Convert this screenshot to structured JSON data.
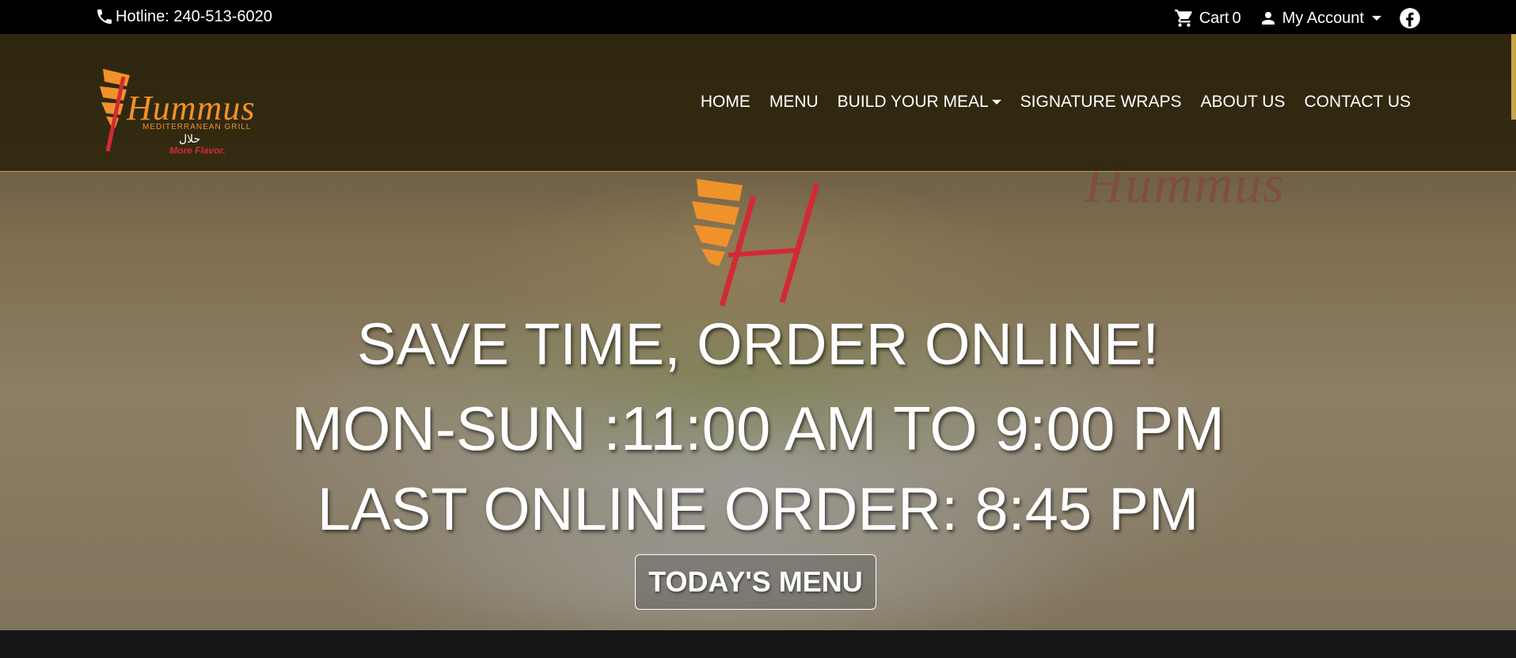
{
  "topbar": {
    "hotline": "Hotline: 240-513-6020",
    "cart_label": "Cart",
    "cart_count": "0",
    "account_label": "My Account"
  },
  "logo": {
    "word": "Hummus",
    "subtitle": "MEDITERRANEAN GRILL",
    "arabic": "حلال",
    "tagline": "More Flavor."
  },
  "nav": {
    "items": [
      "HOME",
      "MENU",
      "BUILD YOUR MEAL",
      "SIGNATURE WRAPS",
      "ABOUT US",
      "CONTACT US"
    ]
  },
  "hero": {
    "ghost_logo": "Hummus",
    "line1": "SAVE TIME, ORDER ONLINE!",
    "line2": "MON-SUN :11:00 AM TO 9:00 PM",
    "line3": "LAST ONLINE ORDER: 8:45 PM",
    "button": "TODAY'S MENU"
  },
  "colors": {
    "brand_orange": "#f0922a",
    "brand_red": "#d22a35",
    "topbar_bg": "#000000"
  }
}
